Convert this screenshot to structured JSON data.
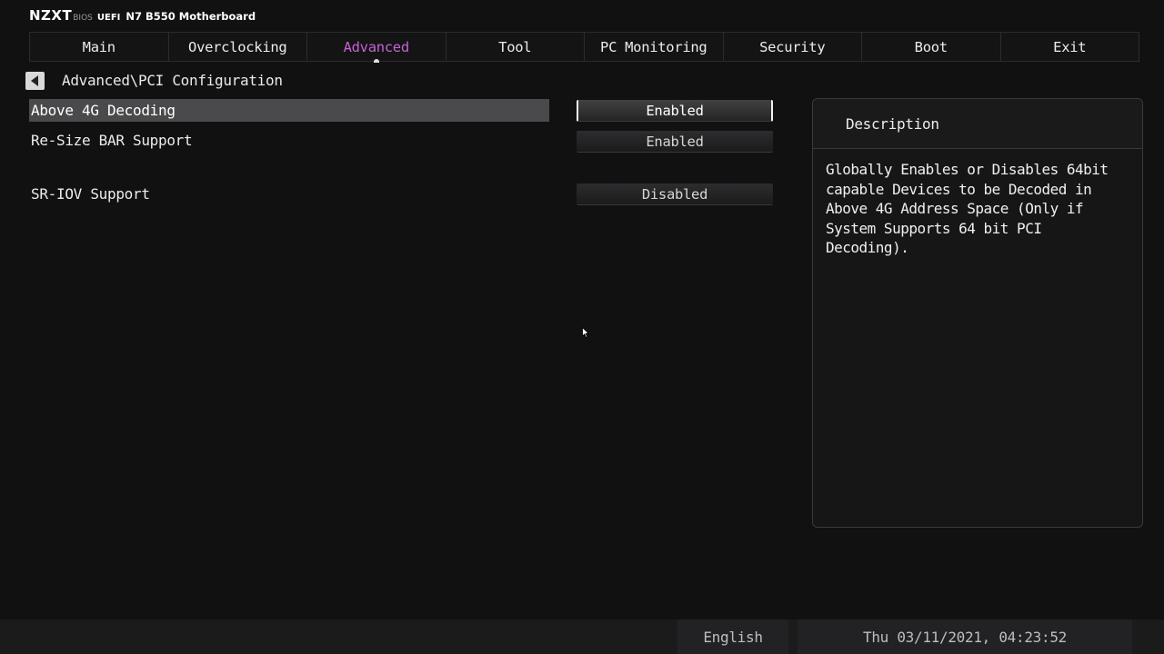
{
  "brand": {
    "logo": "NZXT",
    "bios": "BIOS",
    "uefi": "UEFI",
    "model": "N7 B550 Motherboard"
  },
  "tabs": [
    {
      "label": "Main",
      "active": false
    },
    {
      "label": "Overclocking",
      "active": false
    },
    {
      "label": "Advanced",
      "active": true
    },
    {
      "label": "Tool",
      "active": false
    },
    {
      "label": "PC Monitoring",
      "active": false
    },
    {
      "label": "Security",
      "active": false
    },
    {
      "label": "Boot",
      "active": false
    },
    {
      "label": "Exit",
      "active": false
    }
  ],
  "colors": {
    "active_tab": "#c861d6",
    "background": "#111112",
    "selected_row": "#4a4a4c"
  },
  "breadcrumb": "Advanced\\PCI Configuration",
  "settings": [
    {
      "label": "Above 4G Decoding",
      "value": "Enabled",
      "selected": true
    },
    {
      "label": "Re-Size BAR Support",
      "value": "Enabled",
      "selected": false
    },
    {
      "label": "SR-IOV Support",
      "value": "Disabled",
      "selected": false
    }
  ],
  "description": {
    "title": "Description",
    "text": "Globally Enables or Disables 64bit capable Devices to be Decoded in Above 4G Address Space (Only if System Supports 64 bit PCI Decoding)."
  },
  "status": {
    "language": "English",
    "datetime": "Thu 03/11/2021, 04:23:52"
  }
}
